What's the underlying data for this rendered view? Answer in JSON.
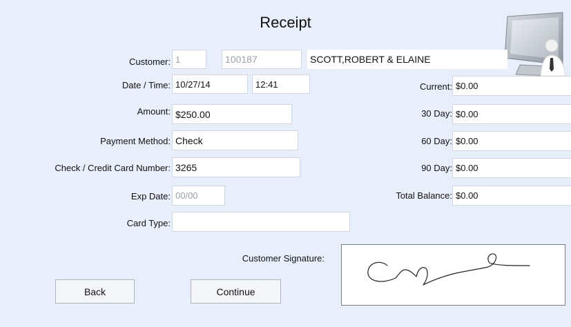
{
  "title": "Receipt",
  "labels": {
    "customer": "Customer:",
    "datetime": "Date / Time:",
    "amount": "Amount:",
    "payment_method": "Payment Method:",
    "card_number": "Check / Credit Card Number:",
    "exp_date": "Exp Date:",
    "card_type": "Card Type:",
    "current": "Current:",
    "day30": "30 Day:",
    "day60": "60 Day:",
    "day90": "90 Day:",
    "total_balance": "Total Balance:",
    "signature": "Customer Signature:"
  },
  "values": {
    "customer_num": "1",
    "customer_id": "100187",
    "customer_name": "SCOTT,ROBERT & ELAINE",
    "date": "10/27/14",
    "time": "12:41",
    "amount": "$250.00",
    "payment_method": "Check",
    "card_number": "3265",
    "exp_date": "00/00",
    "card_type": "",
    "current": "$0.00",
    "day30": "$0.00",
    "day60": "$0.00",
    "day90": "$0.00",
    "total_balance": "$0.00"
  },
  "buttons": {
    "back": "Back",
    "continue": "Continue"
  },
  "icons": {
    "header": "computer-user-icon"
  }
}
